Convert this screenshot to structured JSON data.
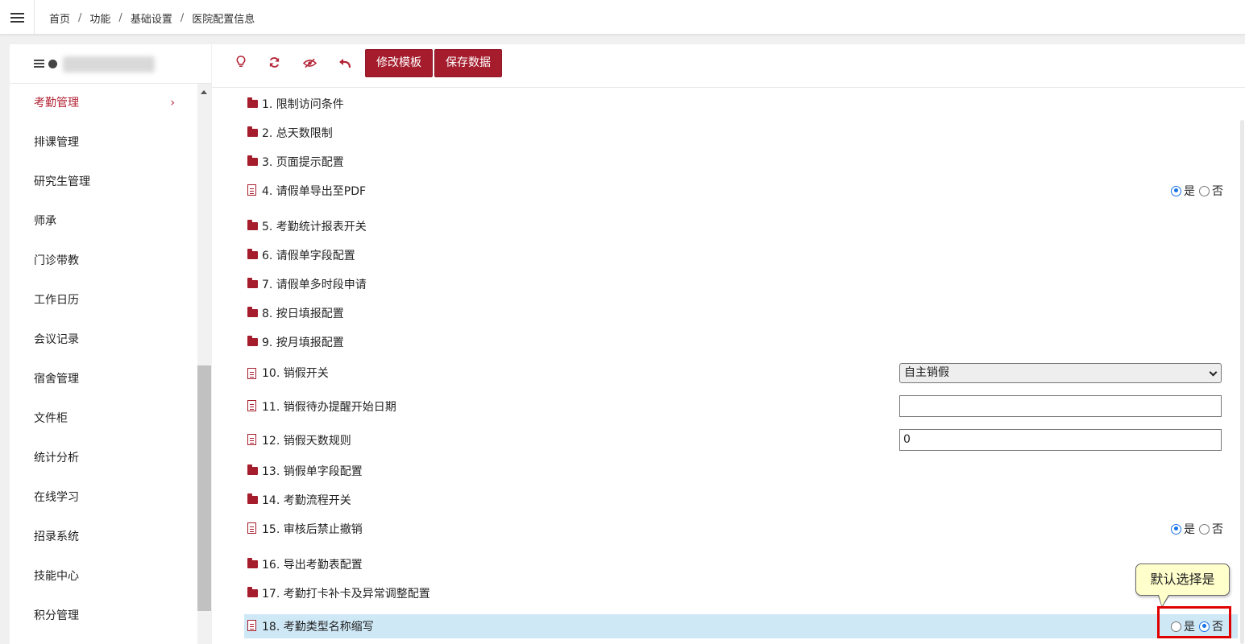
{
  "breadcrumb": [
    "首页",
    "功能",
    "基础设置",
    "医院配置信息"
  ],
  "sidebar": {
    "items": [
      {
        "label": "考勤管理",
        "active": true
      },
      {
        "label": "排课管理"
      },
      {
        "label": "研究生管理"
      },
      {
        "label": "师承"
      },
      {
        "label": "门诊带教"
      },
      {
        "label": "工作日历"
      },
      {
        "label": "会议记录"
      },
      {
        "label": "宿舍管理"
      },
      {
        "label": "文件柜"
      },
      {
        "label": "统计分析"
      },
      {
        "label": "在线学习"
      },
      {
        "label": "招录系统"
      },
      {
        "label": "技能中心"
      },
      {
        "label": "积分管理"
      }
    ],
    "chevron": "›"
  },
  "toolbar": {
    "edit_template": "修改模板",
    "save_data": "保存数据",
    "icons": [
      "lightbulb-icon",
      "refresh-icon",
      "hide-icon",
      "undo-icon"
    ]
  },
  "config": {
    "items": [
      {
        "label": "1. 限制访问条件",
        "kind": "folder"
      },
      {
        "label": "2. 总天数限制",
        "kind": "folder"
      },
      {
        "label": "3. 页面提示配置",
        "kind": "folder"
      },
      {
        "label": "4. 请假单导出至PDF",
        "kind": "doc",
        "yes": "是",
        "no": "否",
        "value": "yes"
      },
      {
        "label": "5. 考勤统计报表开关",
        "kind": "folder"
      },
      {
        "label": "6. 请假单字段配置",
        "kind": "folder"
      },
      {
        "label": "7. 请假单多时段申请",
        "kind": "folder"
      },
      {
        "label": "8. 按日填报配置",
        "kind": "folder"
      },
      {
        "label": "9. 按月填报配置",
        "kind": "folder"
      },
      {
        "label": "10. 销假开关",
        "kind": "doc",
        "select_value": "自主销假"
      },
      {
        "label": "11. 销假待办提醒开始日期",
        "kind": "doc",
        "input_value": ""
      },
      {
        "label": "12. 销假天数规则",
        "kind": "doc",
        "input_value": "0"
      },
      {
        "label": "13. 销假单字段配置",
        "kind": "folder"
      },
      {
        "label": "14. 考勤流程开关",
        "kind": "folder"
      },
      {
        "label": "15. 审核后禁止撤销",
        "kind": "doc",
        "yes": "是",
        "no": "否",
        "value": "yes"
      },
      {
        "label": "16. 导出考勤表配置",
        "kind": "folder"
      },
      {
        "label": "17. 考勤打卡补卡及异常调整配置",
        "kind": "folder"
      },
      {
        "label": "18. 考勤类型名称缩写",
        "kind": "doc",
        "yes": "是",
        "no": "否",
        "value": "no",
        "highlighted": true
      }
    ]
  },
  "tooltip": {
    "text": "默认选择是"
  },
  "colors": {
    "accent": "#a51d2d",
    "highlight": "#cfe8f6",
    "callout": "#e00000",
    "tooltip_bg": "#ffffcc"
  }
}
